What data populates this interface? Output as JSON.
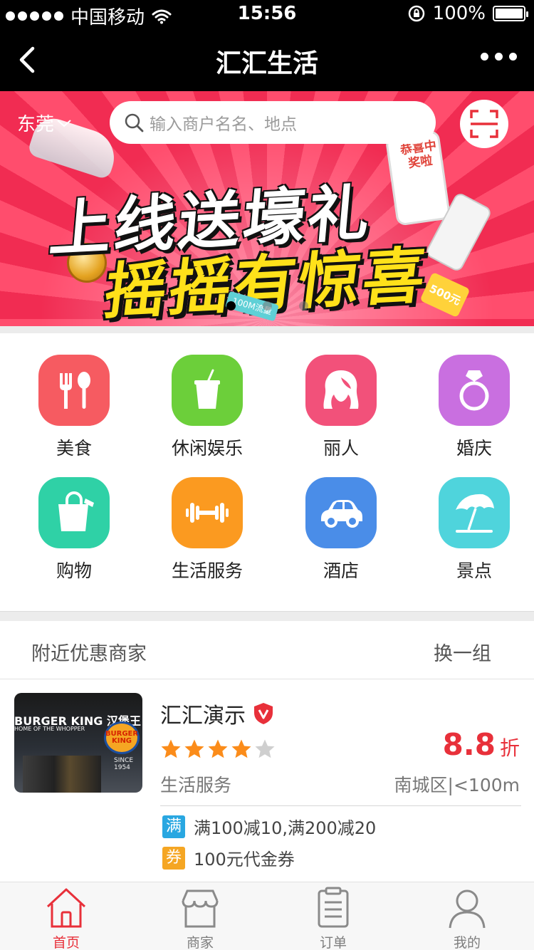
{
  "status_bar": {
    "carrier": "中国移动",
    "time": "15:56",
    "battery": "100%",
    "battery_level": 1.0
  },
  "nav": {
    "title": "汇汇生活"
  },
  "banner": {
    "city": "东莞",
    "search_placeholder": "输入商户名名、地点",
    "headline_1": "上线送壕礼",
    "headline_2": "摇摇有惊喜",
    "phone_text": "恭喜中奖啦",
    "tag_500": "500元",
    "tag_100m": "100M流量",
    "slides": 3,
    "active_slide": 1
  },
  "categories": [
    {
      "label": "美食",
      "icon": "fork-spoon-icon",
      "color": "#f65b61"
    },
    {
      "label": "休闲娱乐",
      "icon": "drink-cup-icon",
      "color": "#6ccf3a"
    },
    {
      "label": "丽人",
      "icon": "hair-icon",
      "color": "#f2517a"
    },
    {
      "label": "婚庆",
      "icon": "ring-icon",
      "color": "#c96fe0"
    },
    {
      "label": "购物",
      "icon": "shopping-bag-icon",
      "color": "#2fd1a6"
    },
    {
      "label": "生活服务",
      "icon": "dumbbell-icon",
      "color": "#fb9a20"
    },
    {
      "label": "酒店",
      "icon": "car-icon",
      "color": "#4a8de8"
    },
    {
      "label": "景点",
      "icon": "beach-umbrella-icon",
      "color": "#4fd4dc"
    }
  ],
  "nearby": {
    "title": "附近优惠商家",
    "refresh": "换一组"
  },
  "merchant": {
    "name": "汇汇演示",
    "rating": 4.5,
    "rating_max": 5,
    "discount_value": "8.8",
    "discount_unit": "折",
    "category": "生活服务",
    "location": "南城区|<100m",
    "thumb_sign": "BURGER KING 汉堡王",
    "thumb_sub": "HOME OF THE WHOPPER",
    "thumb_logo": "BURGER KING",
    "thumb_since": "SINCE 1954",
    "promos": [
      {
        "badge": "满",
        "text": "满100减10,满200减20",
        "color": "#29a7e1"
      },
      {
        "badge": "券",
        "text": "100元代金券",
        "color": "#f5a623"
      }
    ]
  },
  "tabs": [
    {
      "label": "首页",
      "icon": "home-icon",
      "active": true
    },
    {
      "label": "商家",
      "icon": "shop-icon",
      "active": false
    },
    {
      "label": "订单",
      "icon": "clipboard-icon",
      "active": false
    },
    {
      "label": "我的",
      "icon": "user-icon",
      "active": false
    }
  ],
  "colors": {
    "accent": "#e8303a",
    "divider": "#ececec"
  }
}
